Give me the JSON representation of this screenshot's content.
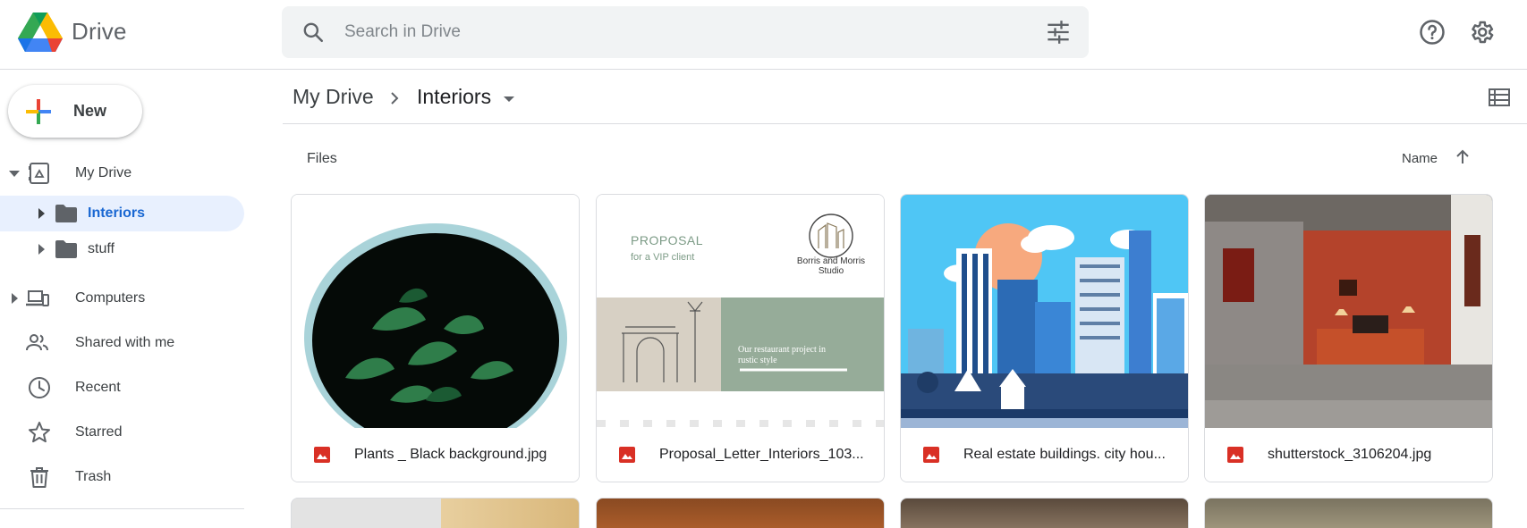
{
  "app": {
    "brand": "Drive"
  },
  "search": {
    "placeholder": "Search in Drive"
  },
  "sidebar": {
    "new_label": "New",
    "items": [
      {
        "label": "My Drive"
      },
      {
        "label": "Interiors"
      },
      {
        "label": "stuff"
      },
      {
        "label": "Computers"
      },
      {
        "label": "Shared with me"
      },
      {
        "label": "Recent"
      },
      {
        "label": "Starred"
      },
      {
        "label": "Trash"
      }
    ]
  },
  "breadcrumb": {
    "root": "My Drive",
    "current": "Interiors"
  },
  "files": {
    "section_label": "Files",
    "sort_label": "Name",
    "items": [
      {
        "name": "Plants _ Black background.jpg",
        "type": "image-file-icon"
      },
      {
        "name": "Proposal_Letter_Interiors_103...",
        "type": "image-file-icon"
      },
      {
        "name": "Real estate buildings. city hou...",
        "type": "image-file-icon"
      },
      {
        "name": "shutterstock_3106204.jpg",
        "type": "image-file-icon"
      }
    ]
  },
  "proposal_thumb": {
    "heading": "PROPOSAL",
    "subheading": "for a VIP client",
    "studio_line1": "Borris and Morris",
    "studio_line2": "Studio",
    "tagline_line1": "Our restaurant project in",
    "tagline_line2": "rustic style"
  },
  "colors": {
    "accent": "#1967d2",
    "active_bg": "#e8f0fe",
    "search_bg": "#f1f3f4",
    "file_icon": "#d93025"
  }
}
